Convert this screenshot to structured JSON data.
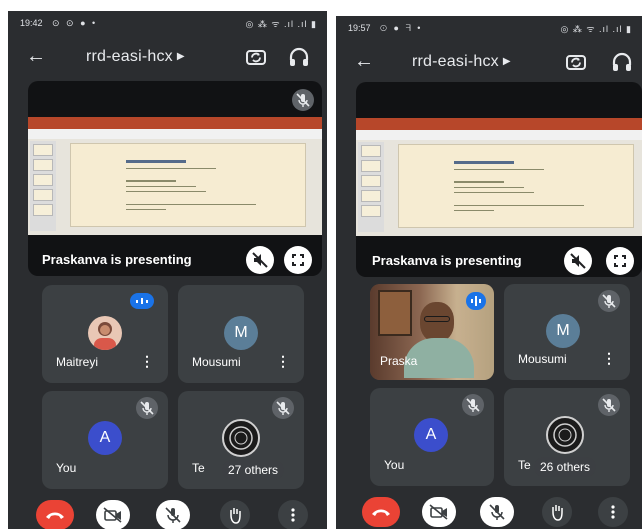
{
  "colors": {
    "phone_bg": "#2b2d30",
    "tile_bg": "#3c4043",
    "end_call": "#ea4335",
    "speaking": "#1a73e8",
    "avatar_purple": "#3b4ecc",
    "avatar_blue": "#5b7e98"
  },
  "screens": [
    {
      "status_time": "19:42",
      "status_left_icons": "⊙ ⊙ ●  •",
      "status_right_icons": "◎ ⁂ ᯤ .ıl .ıl ▮",
      "meeting_title": "rrd-easi-hcx",
      "presenting_text": "Praskanva is presenting",
      "participants": [
        {
          "name": "Maitreyi",
          "avatar_type": "photo",
          "speaking": true
        },
        {
          "name": "Mousumi",
          "avatar_letter": "M"
        },
        {
          "name": "You",
          "avatar_letter": "A",
          "muted": true
        },
        {
          "name": "Te",
          "others_text": "27 others",
          "muted": true
        }
      ],
      "controls": [
        "end-call",
        "camera-off",
        "mic-off",
        "raise-hand",
        "more-options"
      ]
    },
    {
      "status_time": "19:57",
      "status_left_icons": "⊙ ● ᖷ  •",
      "status_right_icons": "◎ ⁂ ᯤ .ıl .ıl ▮",
      "meeting_title": "rrd-easi-hcx",
      "presenting_text": "Praskanva is presenting",
      "participants": [
        {
          "name": "Praska",
          "avatar_type": "video",
          "speaking": true
        },
        {
          "name": "Mousumi",
          "avatar_letter": "M",
          "muted": true
        },
        {
          "name": "You",
          "avatar_letter": "A",
          "muted": true
        },
        {
          "name": "Te",
          "others_text": "26 others",
          "muted": true
        }
      ],
      "controls": [
        "end-call",
        "camera-off",
        "mic-off",
        "raise-hand",
        "more-options"
      ]
    }
  ]
}
